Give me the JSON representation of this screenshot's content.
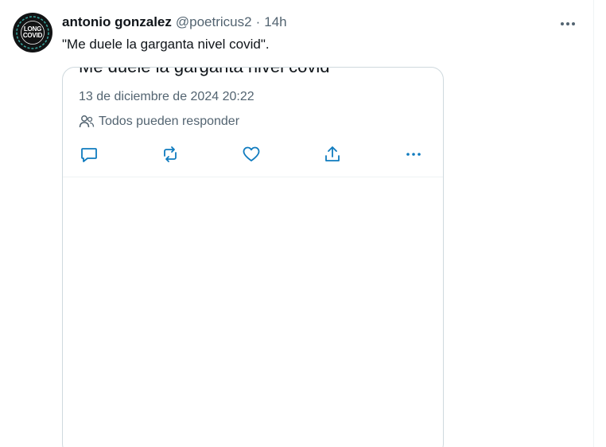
{
  "tweet": {
    "author_name": "antonio gonzalez",
    "author_handle": "@poetricus2",
    "separator": "·",
    "time": "14h",
    "text": "\"Me duele la garganta nivel covid\".",
    "avatar": {
      "line1": "LONG",
      "line2": "COVID",
      "ring_text_top": "LONG HAULER",
      "ring_text_bottom": "AWARENESS"
    }
  },
  "embed": {
    "cutoff_text": "Me duele la garganta nivel covid",
    "timestamp": "13 de diciembre de 2024 20:22",
    "audience": "Todos pueden responder"
  },
  "icons": {
    "more": "more-horizontal-icon",
    "audience": "people-icon",
    "reply": "reply-icon",
    "retweet": "retweet-icon",
    "like": "heart-icon",
    "share": "share-icon",
    "embed_more": "more-horizontal-icon"
  },
  "colors": {
    "text_primary": "#0f1419",
    "text_secondary": "#536471",
    "border": "#cfd9de",
    "divider": "#eff3f4",
    "avatar_bg": "#121314",
    "avatar_ring": "#3aa8a0"
  }
}
